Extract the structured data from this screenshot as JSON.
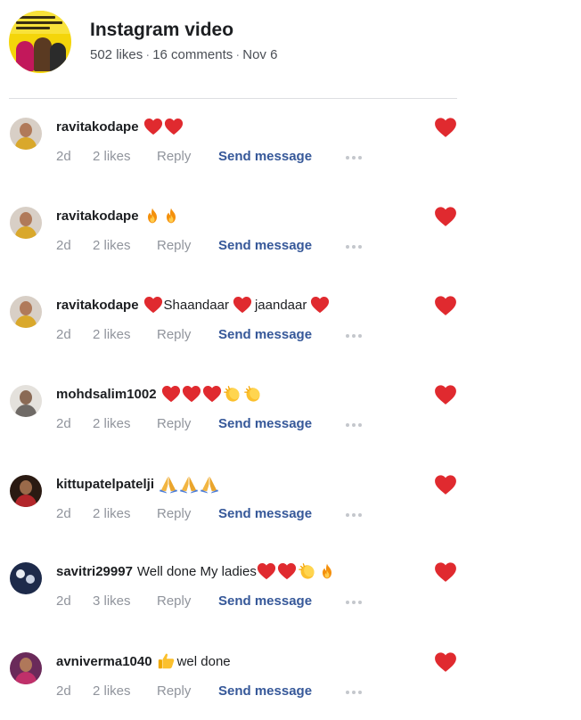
{
  "post": {
    "title": "Instagram video",
    "likes": "502 likes",
    "comments": "16 comments",
    "date": "Nov 6"
  },
  "comment_actions": {
    "reply": "Reply",
    "send": "Send message"
  },
  "comments": [
    {
      "user": "ravitakodape",
      "text": "",
      "emojis": [
        "red-heart",
        "red-heart"
      ],
      "time": "2d",
      "likes": "2 likes"
    },
    {
      "user": "ravitakodape",
      "text": "",
      "emojis": [
        "fire",
        "fire"
      ],
      "time": "2d",
      "likes": "2 likes"
    },
    {
      "user": "ravitakodape",
      "text_parts": [
        "Shaandaar",
        "jaandaar"
      ],
      "emojis": [
        "red-heart",
        "red-heart",
        "red-heart"
      ],
      "time": "2d",
      "likes": "2 likes"
    },
    {
      "user": "mohdsalim1002",
      "text": "",
      "emojis": [
        "red-heart",
        "red-heart",
        "red-heart",
        "clapping-hands",
        "clapping-hands"
      ],
      "time": "2d",
      "likes": "2 likes"
    },
    {
      "user": "kittupatelpatelji",
      "text": "",
      "emojis": [
        "folded-hands",
        "folded-hands",
        "folded-hands"
      ],
      "time": "2d",
      "likes": "2 likes"
    },
    {
      "user": "savitri29997",
      "text": "Well done My ladies",
      "emojis": [
        "red-heart",
        "red-heart",
        "clapping-hands",
        "fire"
      ],
      "time": "2d",
      "likes": "3 likes"
    },
    {
      "user": "avniverma1040",
      "text": "wel done",
      "emojis": [
        "thumbs-up"
      ],
      "time": "2d",
      "likes": "2 likes"
    }
  ],
  "colors": {
    "heart": "#e02a2f",
    "link": "#365899",
    "meta": "#90949c"
  }
}
